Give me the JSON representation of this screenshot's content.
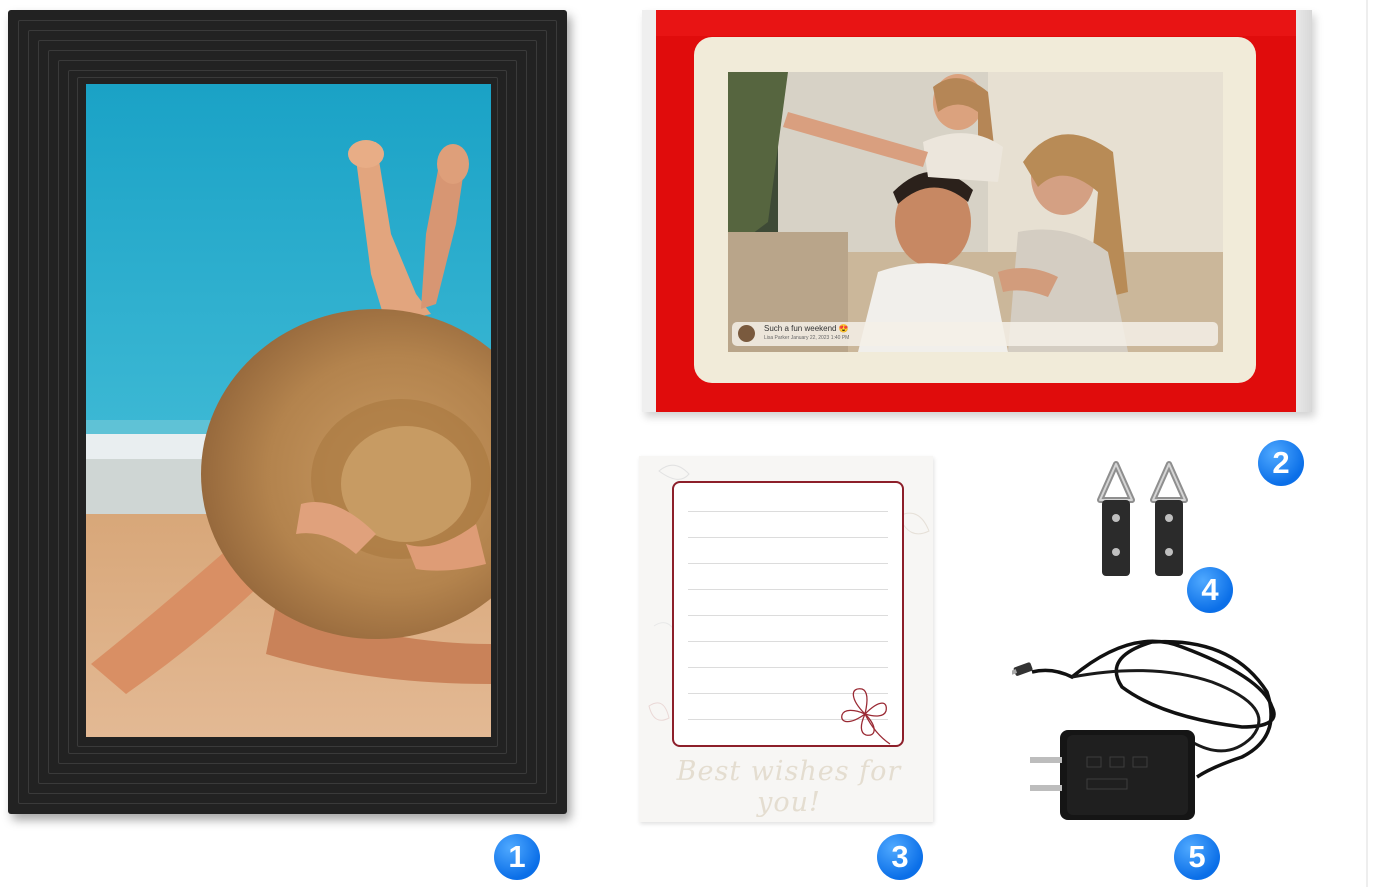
{
  "items": [
    {
      "number": "1",
      "description": "Digital photo frame displaying beach photo"
    },
    {
      "number": "2",
      "description": "Frame screen with protective film"
    },
    {
      "number": "3",
      "description": "Greeting card"
    },
    {
      "number": "4",
      "description": "Wall hangers"
    },
    {
      "number": "5",
      "description": "Power adapter"
    }
  ],
  "greeting_card": {
    "text": "Best wishes for you!"
  },
  "frame_screen": {
    "caption": "Such a fun weekend 😍",
    "caption_user": "Lisa Parker",
    "caption_date": "January 22, 2023 1:40 PM"
  },
  "colors": {
    "badge": "#0b6fe8",
    "packaging_red": "#e00c0c",
    "frame": "#222222",
    "card_border": "#8d1f2a"
  },
  "icons": {
    "badge_shape": "blue-circle-number"
  }
}
